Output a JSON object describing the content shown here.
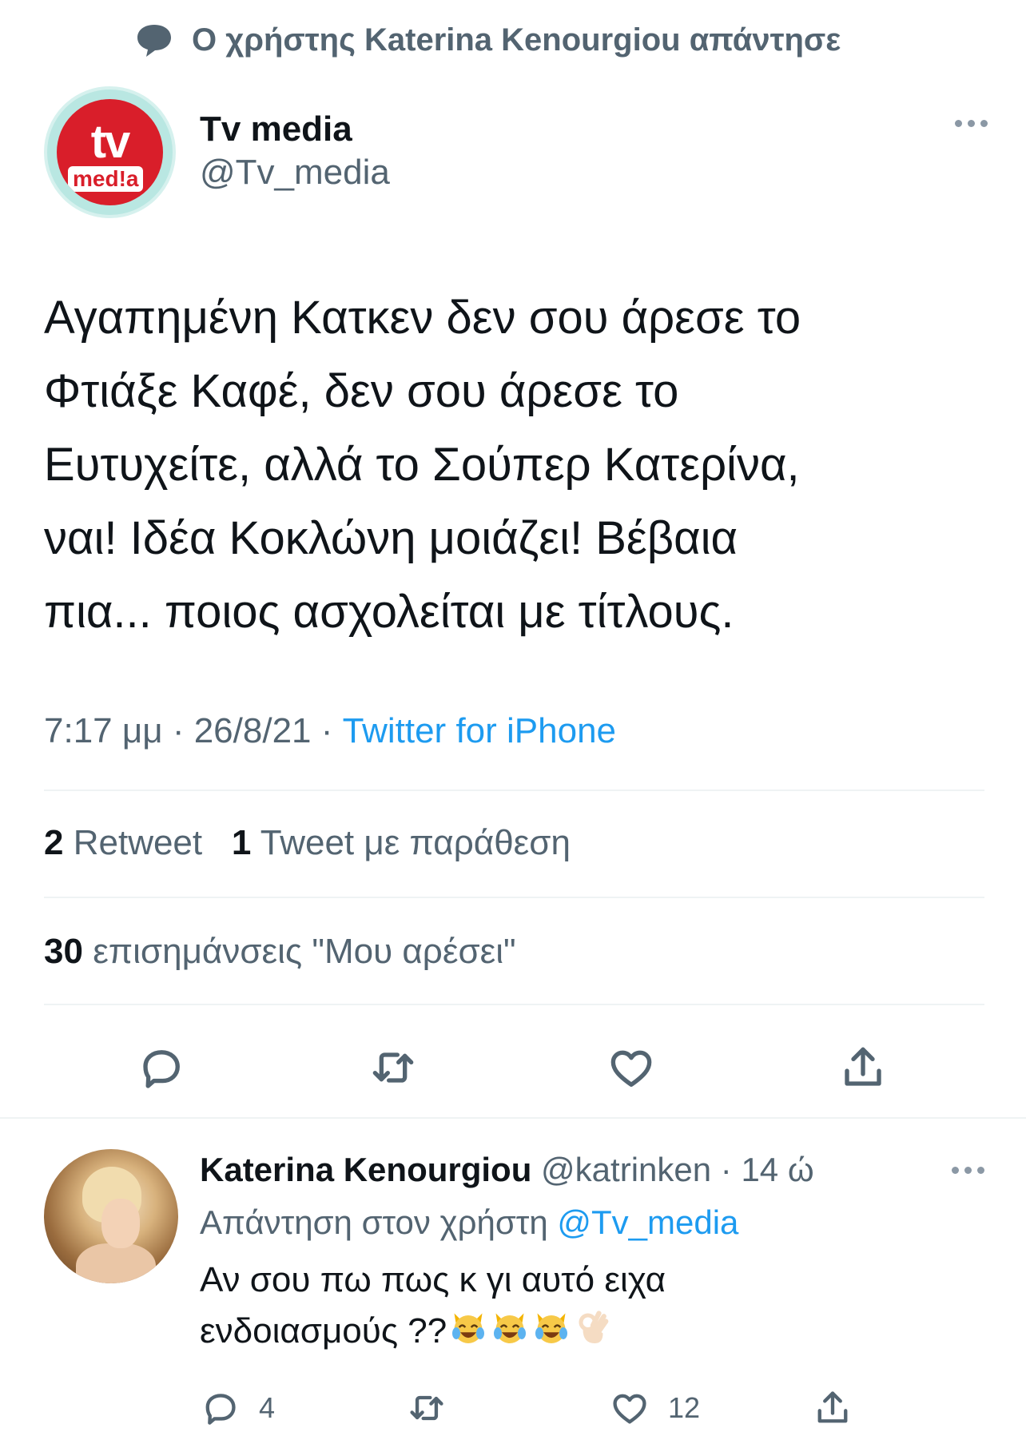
{
  "reply_context": {
    "icon": "speech-bubble-icon",
    "text": "Ο χρήστης Katerina Kenourgiou απάντησε"
  },
  "tweet": {
    "avatar_text_top": "tv",
    "avatar_text_bottom": "med!a",
    "author_name": "Tv media",
    "author_handle": "@Tv_media",
    "text_lines": [
      "Αγαπημένη Κατκεν δεν σου άρεσε το",
      "Φτιάξε Καφέ, δεν σου άρεσε το",
      "Ευτυχείτε, αλλά το Σούπερ Κατερίνα,",
      "ναι! Ιδέα Κοκλώνη μοιάζει! Βέβαια",
      "πια... ποιος ασχολείται με τίτλους."
    ],
    "time": "7:17 μμ",
    "date": "26/8/21",
    "source": "Twitter for iPhone",
    "retweets_count": "2",
    "retweets_label": "Retweet",
    "quotes_count": "1",
    "quotes_label": "Tweet με παράθεση",
    "likes_count": "30",
    "likes_label": "επισημάνσεις \"Μου αρέσει\""
  },
  "reply": {
    "author_name": "Katerina Kenourgiou",
    "author_handle": "@katrinken",
    "time_ago": "14 ώ",
    "replying_prefix": "Απάντηση στον χρήστη",
    "replying_mention": "@Tv_media",
    "text_line1": "Αν σου πω πως κ γι αυτό ειχα",
    "text_line2": "ενδοιασμούς ??",
    "emojis": [
      "cat-tears-of-joy",
      "cat-tears-of-joy",
      "cat-tears-of-joy",
      "ok-hand"
    ],
    "reply_count": "4",
    "like_count": "12"
  },
  "colors": {
    "accent": "#1d9bf0",
    "secondary_text": "#536471",
    "primary_text": "#0f1419",
    "tv_brand_red": "#d91e2a"
  }
}
